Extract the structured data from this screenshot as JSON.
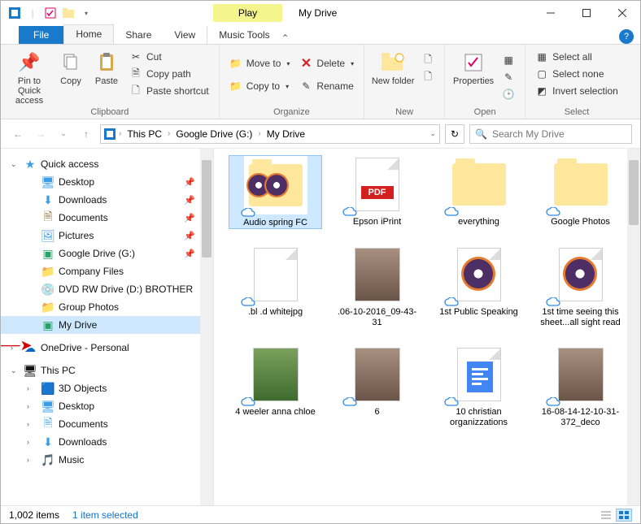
{
  "titlebar": {
    "play_label": "Play",
    "title": "My Drive"
  },
  "tabs": {
    "file": "File",
    "home": "Home",
    "share": "Share",
    "view": "View",
    "music_tools": "Music Tools"
  },
  "ribbon": {
    "clipboard": {
      "pin": "Pin to Quick access",
      "copy": "Copy",
      "paste": "Paste",
      "cut": "Cut",
      "copy_path": "Copy path",
      "paste_shortcut": "Paste shortcut",
      "label": "Clipboard"
    },
    "organize": {
      "move_to": "Move to",
      "copy_to": "Copy to",
      "delete": "Delete",
      "rename": "Rename",
      "label": "Organize"
    },
    "new": {
      "new_folder": "New folder",
      "label": "New"
    },
    "open": {
      "properties": "Properties",
      "label": "Open"
    },
    "select": {
      "select_all": "Select all",
      "select_none": "Select none",
      "invert": "Invert selection",
      "label": "Select"
    }
  },
  "address": {
    "crumbs": [
      "This PC",
      "Google Drive (G:)",
      "My Drive"
    ],
    "search_placeholder": "Search My Drive"
  },
  "tree": {
    "quick_access": "Quick access",
    "items_qa": [
      {
        "label": "Desktop",
        "pin": true
      },
      {
        "label": "Downloads",
        "pin": true
      },
      {
        "label": "Documents",
        "pin": true
      },
      {
        "label": "Pictures",
        "pin": true
      },
      {
        "label": "Google Drive (G:)",
        "pin": true
      },
      {
        "label": "Company Files"
      },
      {
        "label": "DVD RW Drive (D:) BROTHER"
      },
      {
        "label": "Group Photos"
      },
      {
        "label": "My Drive",
        "selected": true
      }
    ],
    "onedrive": "OneDrive - Personal",
    "this_pc": "This PC",
    "items_pc": [
      {
        "label": "3D Objects"
      },
      {
        "label": "Desktop"
      },
      {
        "label": "Documents"
      },
      {
        "label": "Downloads"
      },
      {
        "label": "Music"
      }
    ]
  },
  "files": [
    {
      "name": "Audio spring FC",
      "kind": "folder-discs",
      "selected": true,
      "cloud": true
    },
    {
      "name": "Epson iPrint",
      "kind": "pdf",
      "cloud": true
    },
    {
      "name": "everything",
      "kind": "folder",
      "cloud": true
    },
    {
      "name": "Google Photos",
      "kind": "folder",
      "cloud": true
    },
    {
      "name": ".bl    .d whitejpg",
      "kind": "paper",
      "cloud": true
    },
    {
      "name": ".06-10-2016_09-43-31",
      "kind": "photo",
      "cloud": false
    },
    {
      "name": "1st Public Speaking",
      "kind": "disc",
      "cloud": true
    },
    {
      "name": "1st time seeing this sheet...all sight read",
      "kind": "disc",
      "cloud": true
    },
    {
      "name": "4 weeler anna chloe",
      "kind": "photo-green",
      "cloud": true
    },
    {
      "name": "6",
      "kind": "photo",
      "cloud": true
    },
    {
      "name": "10 christian organizzations",
      "kind": "gdoc",
      "cloud": true
    },
    {
      "name": "16-08-14-12-10-31-372_deco",
      "kind": "photo",
      "cloud": true
    }
  ],
  "status": {
    "count": "1,002 items",
    "selected": "1 item selected"
  }
}
